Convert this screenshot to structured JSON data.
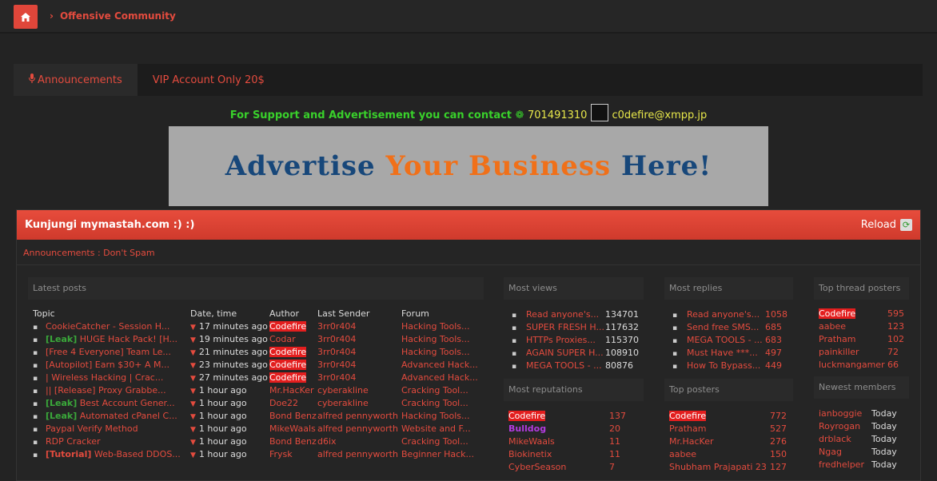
{
  "header": {
    "home_icon": "home-icon",
    "breadcrumb": "Offensive Community"
  },
  "tabs": [
    {
      "label": "Announcements",
      "icon": "microphone-icon"
    },
    {
      "label": "VIP Account Only 20$"
    }
  ],
  "support": {
    "text": "For Support and Advertisement you can contact",
    "icq": "701491310",
    "xmpp": "c0defire@xmpp.jp"
  },
  "ad": {
    "part1": "Advertise",
    "part2": "Your Business",
    "part3": "Here!"
  },
  "shoutbox": {
    "title": "Kunjungi mymastah.com :) :)",
    "reload": "Reload",
    "announcement": "Announcements : Don't Spam"
  },
  "latest": {
    "title": "Latest posts",
    "headers": [
      "Topic",
      "Date, time",
      "Author",
      "Last Sender",
      "Forum"
    ],
    "rows": [
      {
        "tag": "",
        "topic": "CookieCatcher - Session H...",
        "time": "17 minutes ago",
        "author": "Codefire",
        "sender": "3rr0r404",
        "forum": "Hacking Tools..."
      },
      {
        "tag": "[Leak]",
        "topic": "HUGE Hack Pack! [H...",
        "time": "19 minutes ago",
        "author": "Codar",
        "sender": "3rr0r404",
        "forum": "Hacking Tools..."
      },
      {
        "tag": "",
        "topic": "[Free 4 Everyone] Team Le...",
        "time": "21 minutes ago",
        "author": "Codefire",
        "sender": "3rr0r404",
        "forum": "Hacking Tools..."
      },
      {
        "tag": "",
        "topic": "[Autopilot] Earn $30+ A M...",
        "time": "23 minutes ago",
        "author": "Codefire",
        "sender": "3rr0r404",
        "forum": "Advanced Hack..."
      },
      {
        "tag": "",
        "topic": "| Wireless Hacking | Crac...",
        "time": "27 minutes ago",
        "author": "Codefire",
        "sender": "3rr0r404",
        "forum": "Advanced Hack..."
      },
      {
        "tag": "",
        "topic": "|| [Release] Proxy Grabbe...",
        "time": "1 hour ago",
        "author": "Mr.HacKer",
        "sender": "cyberakline",
        "forum": "Cracking Tool..."
      },
      {
        "tag": "[Leak]",
        "topic": "Best Account Gener...",
        "time": "1 hour ago",
        "author": "Doe22",
        "sender": "cyberakline",
        "forum": "Cracking Tool..."
      },
      {
        "tag": "[Leak]",
        "topic": "Automated cPanel C...",
        "time": "1 hour ago",
        "author": "Bond Benz",
        "sender": "alfred pennyworth",
        "forum": "Hacking Tools..."
      },
      {
        "tag": "",
        "topic": "Paypal Verify Method",
        "time": "1 hour ago",
        "author": "MikeWaals",
        "sender": "alfred pennyworth",
        "forum": "Website and F..."
      },
      {
        "tag": "",
        "topic": "RDP Cracker",
        "time": "1 hour ago",
        "author": "Bond Benz",
        "sender": "d6ix",
        "forum": "Cracking Tool..."
      },
      {
        "tag": "[Tutorial]",
        "topic": "Web-Based DDOS...",
        "time": "1 hour ago",
        "author": "Frysk",
        "sender": "alfred pennyworth",
        "forum": "Beginner Hack..."
      }
    ]
  },
  "most_views": {
    "title": "Most views",
    "rows": [
      {
        "topic": "Read anyone's...",
        "count": "134701"
      },
      {
        "topic": "SUPER FRESH H...",
        "count": "117632"
      },
      {
        "topic": "HTTPs Proxies...",
        "count": "115370"
      },
      {
        "topic": "AGAIN SUPER H...",
        "count": "108910"
      },
      {
        "topic": "MEGA TOOLS - ...",
        "count": "80876"
      }
    ]
  },
  "most_replies": {
    "title": "Most replies",
    "rows": [
      {
        "topic": "Read anyone's...",
        "count": "1058"
      },
      {
        "topic": "Send free SMS...",
        "count": "685"
      },
      {
        "topic": "MEGA TOOLS - ...",
        "count": "683"
      },
      {
        "topic": "Must Have ***...",
        "count": "497"
      },
      {
        "topic": "How To Bypass...",
        "count": "449"
      }
    ]
  },
  "top_thread": {
    "title": "Top thread posters",
    "rows": [
      {
        "name": "Codefire",
        "count": "595"
      },
      {
        "name": "aabee",
        "count": "123"
      },
      {
        "name": "Pratham",
        "count": "102"
      },
      {
        "name": "painkiller",
        "count": "72"
      },
      {
        "name": "luckmangamer",
        "count": "66"
      }
    ]
  },
  "most_rep": {
    "title": "Most reputations",
    "rows": [
      {
        "name": "Codefire",
        "count": "137"
      },
      {
        "name": "Bulldog",
        "count": "20"
      },
      {
        "name": "MikeWaals",
        "count": "11"
      },
      {
        "name": "Biokinetix",
        "count": "11"
      },
      {
        "name": "CyberSeason",
        "count": "7"
      }
    ]
  },
  "top_posters": {
    "title": "Top posters",
    "rows": [
      {
        "name": "Codefire",
        "count": "772"
      },
      {
        "name": "Pratham",
        "count": "527"
      },
      {
        "name": "Mr.HacKer",
        "count": "276"
      },
      {
        "name": "aabee",
        "count": "150"
      },
      {
        "name": "Shubham Prajapati 23",
        "count": "127"
      }
    ]
  },
  "newest": {
    "title": "Newest members",
    "rows": [
      {
        "name": "ianboggie",
        "when": "Today"
      },
      {
        "name": "Royrogan",
        "when": "Today"
      },
      {
        "name": "drblack",
        "when": "Today"
      },
      {
        "name": "Ngag",
        "when": "Today"
      },
      {
        "name": "fredhelper",
        "when": "Today"
      }
    ]
  }
}
